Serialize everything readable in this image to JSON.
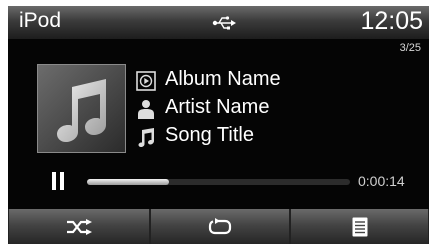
{
  "status_bar": {
    "source": "iPod",
    "usb_icon": "usb-icon",
    "clock": "12:05"
  },
  "track_counter": "3/25",
  "album_art_icon": "music-note-icon",
  "now_playing": {
    "album": {
      "icon": "album-icon",
      "text": "Album Name"
    },
    "artist": {
      "icon": "person-icon",
      "text": "Artist Name"
    },
    "song": {
      "icon": "music-note-icon",
      "text": "Song Title"
    }
  },
  "playback": {
    "state_icon": "pause-icon",
    "progress_fraction": 0.31,
    "elapsed": "0:00:14"
  },
  "bottom_buttons": [
    {
      "name": "shuffle-button",
      "icon": "shuffle-icon"
    },
    {
      "name": "repeat-button",
      "icon": "repeat-icon"
    },
    {
      "name": "list-button",
      "icon": "list-icon"
    }
  ],
  "colors": {
    "background": "#050505",
    "text": "#ffffff",
    "bar_gradient_top": "#6a6a6a",
    "bar_gradient_bottom": "#1d1d1d"
  }
}
